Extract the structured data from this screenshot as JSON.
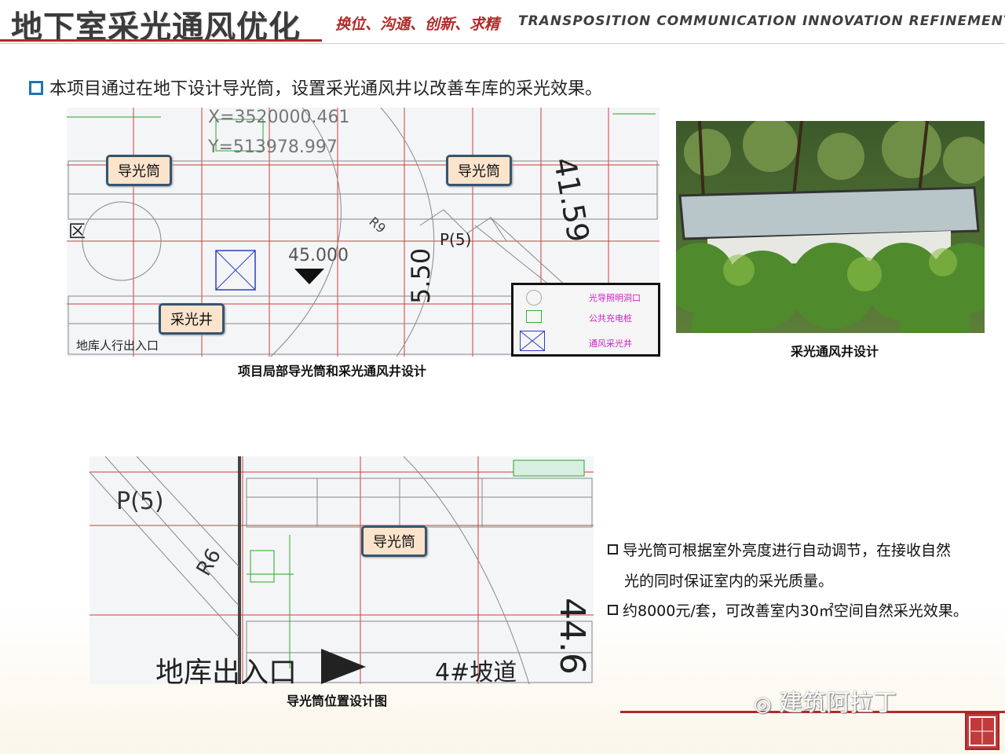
{
  "header": {
    "title": "地下室采光通风优化",
    "slogan_cn": "换位、沟通、创新、求精",
    "slogan_en": "TRANSPOSITION COMMUNICATION INNOVATION REFINEMENT"
  },
  "intro": "本项目通过在地下设计导光筒，设置采光通风井以改善车库的采光效果。",
  "plan_top": {
    "caption": "项目局部导光筒和采光通风井设计",
    "callouts": [
      "导光筒",
      "导光筒",
      "采光井"
    ],
    "cad_labels": {
      "coord_x": "X=3520000.461",
      "coord_y": "Y=513978.997",
      "dim_1": "41.59",
      "dim_2": "45.000",
      "dim_3": "5.50",
      "p5": "P(5)",
      "r9": "R9",
      "zone": "区",
      "entry": "地库人行出入口"
    },
    "legend": [
      "光导照明洞口",
      "公共充电桩",
      "通风采光井"
    ]
  },
  "photo": {
    "caption": "采光通风井设计"
  },
  "plan_bottom": {
    "caption": "导光筒位置设计图",
    "callout": "导光筒",
    "cad_labels": {
      "p5": "P(5)",
      "r6": "R6",
      "exit": "地库出入口",
      "ramp": "4#坡道",
      "dim": "44.6"
    }
  },
  "notes": [
    "导光筒可根据室外亮度进行自动调节，在接收自然",
    "光的同时保证室内的采光质量。",
    "约8000元/套，可改善室内30㎡空间自然采光效果。"
  ],
  "watermark": "建筑阿拉丁",
  "colors": {
    "accent_red": "#b02a2a",
    "bullet_blue": "#1b74b8",
    "callout_fill": "#fbe3cc",
    "callout_border": "#35556f",
    "legend_text": "#d11fc8"
  }
}
